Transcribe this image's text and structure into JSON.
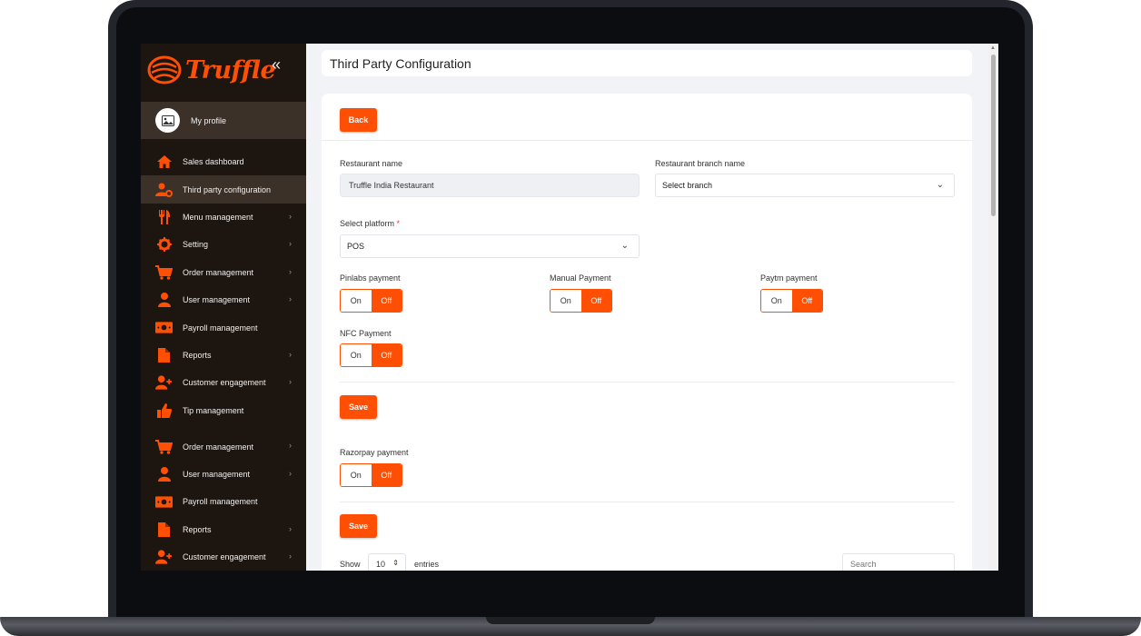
{
  "brand": {
    "name": "Truffle",
    "accent_color": "#ff4f05"
  },
  "profile": {
    "label": "My profile"
  },
  "sidebar": {
    "items": [
      {
        "label": "Sales dashboard",
        "icon": "home-icon",
        "chevron": false
      },
      {
        "label": "Third party configuration",
        "icon": "user-gear-icon",
        "chevron": false,
        "active": true
      },
      {
        "label": "Menu management",
        "icon": "utensils-icon",
        "chevron": true
      },
      {
        "label": "Setting",
        "icon": "gear-icon",
        "chevron": true
      },
      {
        "label": "Order management",
        "icon": "cart-icon",
        "chevron": true
      },
      {
        "label": "User management",
        "icon": "user-icon",
        "chevron": true
      },
      {
        "label": "Payroll management",
        "icon": "money-icon",
        "chevron": false
      },
      {
        "label": "Reports",
        "icon": "file-icon",
        "chevron": true
      },
      {
        "label": "Customer engagement",
        "icon": "user-plus-icon",
        "chevron": true
      },
      {
        "label": "Tip management",
        "icon": "thumbs-up-icon",
        "chevron": false
      },
      {
        "label": "Order management",
        "icon": "cart-icon",
        "chevron": true
      },
      {
        "label": "User management",
        "icon": "user-icon",
        "chevron": true
      },
      {
        "label": "Payroll management",
        "icon": "money-icon",
        "chevron": false
      },
      {
        "label": "Reports",
        "icon": "file-icon",
        "chevron": true
      },
      {
        "label": "Customer engagement",
        "icon": "user-plus-icon",
        "chevron": true
      }
    ]
  },
  "header": {
    "title": "Third Party Configuration"
  },
  "form": {
    "back_label": "Back",
    "restaurant_name_label": "Restaurant name",
    "restaurant_name_value": "Truffle India Restaurant",
    "branch_label": "Restaurant branch name",
    "branch_value": "Select branch",
    "platform_label": "Select platform",
    "platform_required": "*",
    "platform_value": "POS",
    "payments": [
      {
        "label": "Pinlabs payment",
        "on": "On",
        "off": "Off",
        "state": "Off"
      },
      {
        "label": "Manual Payment",
        "on": "On",
        "off": "Off",
        "state": "Off"
      },
      {
        "label": "Paytm payment",
        "on": "On",
        "off": "Off",
        "state": "Off"
      },
      {
        "label": "NFC Payment",
        "on": "On",
        "off": "Off",
        "state": "Off"
      }
    ],
    "save_label": "Save",
    "razorpay": {
      "label": "Razorpay payment",
      "on": "On",
      "off": "Off",
      "state": "Off"
    },
    "save2_label": "Save"
  },
  "table_controls": {
    "show_label": "Show",
    "entries_value": "10",
    "entries_label": "entries",
    "search_placeholder": "Search"
  }
}
